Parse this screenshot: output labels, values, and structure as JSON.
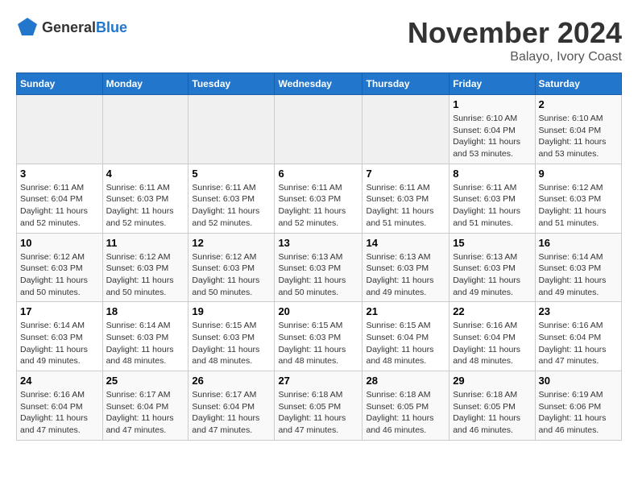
{
  "logo": {
    "general": "General",
    "blue": "Blue"
  },
  "title": "November 2024",
  "location": "Balayo, Ivory Coast",
  "weekdays": [
    "Sunday",
    "Monday",
    "Tuesday",
    "Wednesday",
    "Thursday",
    "Friday",
    "Saturday"
  ],
  "weeks": [
    [
      {
        "day": "",
        "empty": true
      },
      {
        "day": "",
        "empty": true
      },
      {
        "day": "",
        "empty": true
      },
      {
        "day": "",
        "empty": true
      },
      {
        "day": "",
        "empty": true
      },
      {
        "day": "1",
        "sunrise": "6:10 AM",
        "sunset": "6:04 PM",
        "daylight": "11 hours and 53 minutes."
      },
      {
        "day": "2",
        "sunrise": "6:10 AM",
        "sunset": "6:04 PM",
        "daylight": "11 hours and 53 minutes."
      }
    ],
    [
      {
        "day": "3",
        "sunrise": "6:11 AM",
        "sunset": "6:04 PM",
        "daylight": "11 hours and 52 minutes."
      },
      {
        "day": "4",
        "sunrise": "6:11 AM",
        "sunset": "6:03 PM",
        "daylight": "11 hours and 52 minutes."
      },
      {
        "day": "5",
        "sunrise": "6:11 AM",
        "sunset": "6:03 PM",
        "daylight": "11 hours and 52 minutes."
      },
      {
        "day": "6",
        "sunrise": "6:11 AM",
        "sunset": "6:03 PM",
        "daylight": "11 hours and 52 minutes."
      },
      {
        "day": "7",
        "sunrise": "6:11 AM",
        "sunset": "6:03 PM",
        "daylight": "11 hours and 51 minutes."
      },
      {
        "day": "8",
        "sunrise": "6:11 AM",
        "sunset": "6:03 PM",
        "daylight": "11 hours and 51 minutes."
      },
      {
        "day": "9",
        "sunrise": "6:12 AM",
        "sunset": "6:03 PM",
        "daylight": "11 hours and 51 minutes."
      }
    ],
    [
      {
        "day": "10",
        "sunrise": "6:12 AM",
        "sunset": "6:03 PM",
        "daylight": "11 hours and 50 minutes."
      },
      {
        "day": "11",
        "sunrise": "6:12 AM",
        "sunset": "6:03 PM",
        "daylight": "11 hours and 50 minutes."
      },
      {
        "day": "12",
        "sunrise": "6:12 AM",
        "sunset": "6:03 PM",
        "daylight": "11 hours and 50 minutes."
      },
      {
        "day": "13",
        "sunrise": "6:13 AM",
        "sunset": "6:03 PM",
        "daylight": "11 hours and 50 minutes."
      },
      {
        "day": "14",
        "sunrise": "6:13 AM",
        "sunset": "6:03 PM",
        "daylight": "11 hours and 49 minutes."
      },
      {
        "day": "15",
        "sunrise": "6:13 AM",
        "sunset": "6:03 PM",
        "daylight": "11 hours and 49 minutes."
      },
      {
        "day": "16",
        "sunrise": "6:14 AM",
        "sunset": "6:03 PM",
        "daylight": "11 hours and 49 minutes."
      }
    ],
    [
      {
        "day": "17",
        "sunrise": "6:14 AM",
        "sunset": "6:03 PM",
        "daylight": "11 hours and 49 minutes."
      },
      {
        "day": "18",
        "sunrise": "6:14 AM",
        "sunset": "6:03 PM",
        "daylight": "11 hours and 48 minutes."
      },
      {
        "day": "19",
        "sunrise": "6:15 AM",
        "sunset": "6:03 PM",
        "daylight": "11 hours and 48 minutes."
      },
      {
        "day": "20",
        "sunrise": "6:15 AM",
        "sunset": "6:03 PM",
        "daylight": "11 hours and 48 minutes."
      },
      {
        "day": "21",
        "sunrise": "6:15 AM",
        "sunset": "6:04 PM",
        "daylight": "11 hours and 48 minutes."
      },
      {
        "day": "22",
        "sunrise": "6:16 AM",
        "sunset": "6:04 PM",
        "daylight": "11 hours and 48 minutes."
      },
      {
        "day": "23",
        "sunrise": "6:16 AM",
        "sunset": "6:04 PM",
        "daylight": "11 hours and 47 minutes."
      }
    ],
    [
      {
        "day": "24",
        "sunrise": "6:16 AM",
        "sunset": "6:04 PM",
        "daylight": "11 hours and 47 minutes."
      },
      {
        "day": "25",
        "sunrise": "6:17 AM",
        "sunset": "6:04 PM",
        "daylight": "11 hours and 47 minutes."
      },
      {
        "day": "26",
        "sunrise": "6:17 AM",
        "sunset": "6:04 PM",
        "daylight": "11 hours and 47 minutes."
      },
      {
        "day": "27",
        "sunrise": "6:18 AM",
        "sunset": "6:05 PM",
        "daylight": "11 hours and 47 minutes."
      },
      {
        "day": "28",
        "sunrise": "6:18 AM",
        "sunset": "6:05 PM",
        "daylight": "11 hours and 46 minutes."
      },
      {
        "day": "29",
        "sunrise": "6:18 AM",
        "sunset": "6:05 PM",
        "daylight": "11 hours and 46 minutes."
      },
      {
        "day": "30",
        "sunrise": "6:19 AM",
        "sunset": "6:06 PM",
        "daylight": "11 hours and 46 minutes."
      }
    ]
  ]
}
